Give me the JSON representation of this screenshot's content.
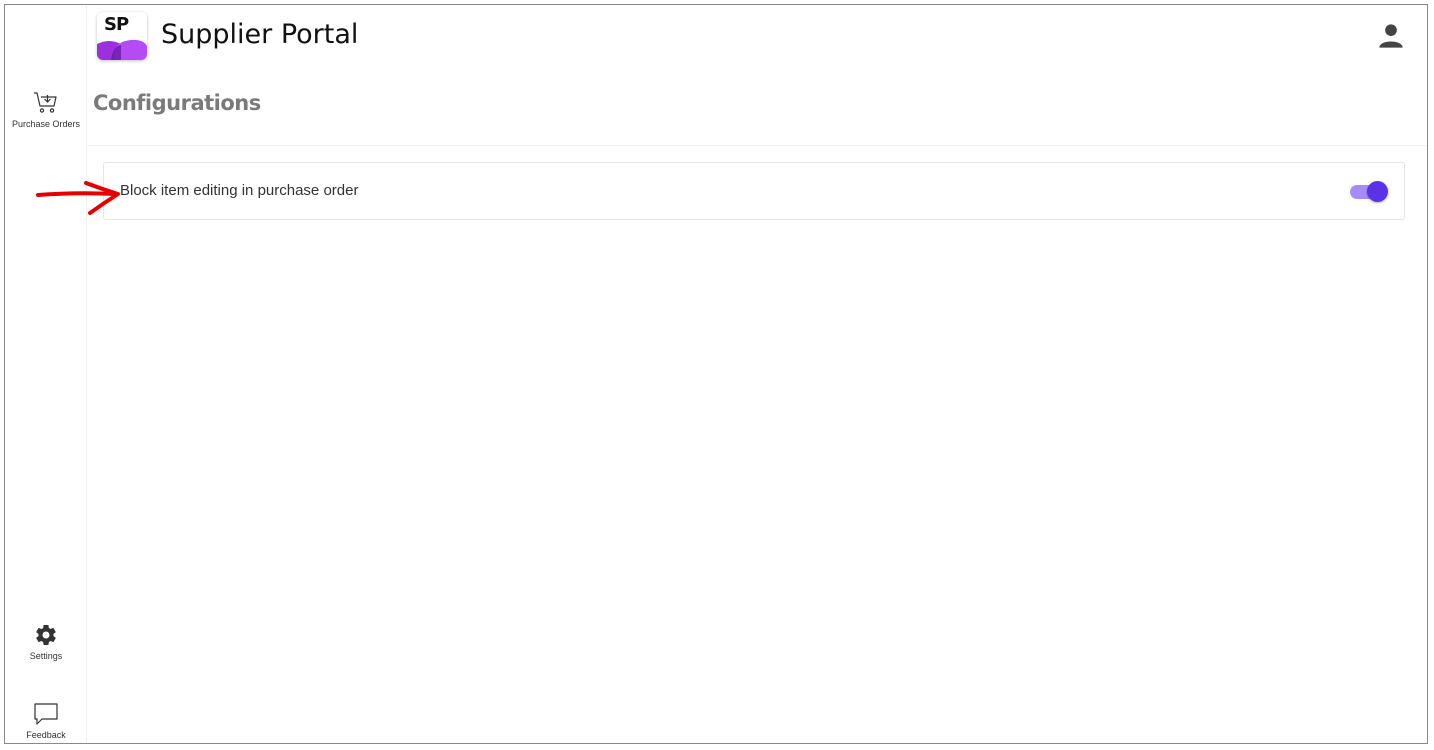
{
  "app": {
    "title": "Supplier Portal",
    "logo_text": "SP"
  },
  "sidebar": {
    "items": [
      {
        "label": "Purchase Orders",
        "icon": "cart-download-icon"
      },
      {
        "label": "Settings",
        "icon": "gear-icon"
      },
      {
        "label": "Feedback",
        "icon": "chat-bubble-icon"
      }
    ]
  },
  "page": {
    "title": "Configurations"
  },
  "configurations": [
    {
      "label": "Block item editing in purchase order",
      "enabled": true
    }
  ],
  "colors": {
    "accent": "#5b32e8",
    "toggle_track": "#a78bfa",
    "logo_purple": "#a63cf2",
    "annotation_arrow": "#e60000"
  }
}
